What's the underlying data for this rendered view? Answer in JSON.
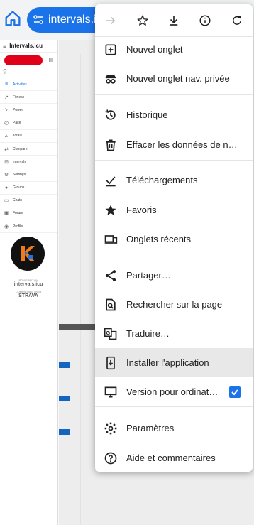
{
  "browser": {
    "url": "intervals.icu"
  },
  "app": {
    "title": "Intervals.icu",
    "sidebar": [
      {
        "label": "Activities",
        "icon": "list-icon"
      },
      {
        "label": "Fitness",
        "icon": "trend-icon"
      },
      {
        "label": "Power",
        "icon": "bolt-icon"
      },
      {
        "label": "Pace",
        "icon": "stopwatch-icon"
      },
      {
        "label": "Totals",
        "icon": "sum-icon"
      },
      {
        "label": "Compare",
        "icon": "compare-icon"
      },
      {
        "label": "Intervals",
        "icon": "intervals-icon"
      },
      {
        "label": "Settings",
        "icon": "gear-icon"
      },
      {
        "label": "Groups",
        "icon": "group-icon"
      },
      {
        "label": "Chats",
        "icon": "chat-icon"
      },
      {
        "label": "Forum",
        "icon": "forum-icon"
      },
      {
        "label": "Profile",
        "icon": "profile-icon"
      }
    ],
    "powered_by": "POWERED BY",
    "powered_brand": "intervals.icu",
    "compat": "COMPATIBLE WITH",
    "strava": "STRAVA"
  },
  "menu": {
    "items": [
      {
        "label": "Nouvel onglet",
        "icon": "new-tab-icon"
      },
      {
        "label": "Nouvel onglet nav. privée",
        "icon": "incognito-icon"
      },
      {
        "label": "Historique",
        "icon": "history-icon"
      },
      {
        "label": "Effacer les données de navi…",
        "icon": "trash-icon"
      },
      {
        "label": "Téléchargements",
        "icon": "downloads-icon"
      },
      {
        "label": "Favoris",
        "icon": "star-icon"
      },
      {
        "label": "Onglets récents",
        "icon": "devices-icon"
      },
      {
        "label": "Partager…",
        "icon": "share-icon"
      },
      {
        "label": "Rechercher sur la page",
        "icon": "find-in-page-icon"
      },
      {
        "label": "Traduire…",
        "icon": "translate-icon"
      },
      {
        "label": "Installer l'application",
        "icon": "install-app-icon"
      },
      {
        "label": "Version pour ordinat…",
        "icon": "desktop-icon"
      },
      {
        "label": "Paramètres",
        "icon": "gear-icon"
      },
      {
        "label": "Aide et commentaires",
        "icon": "help-icon"
      }
    ],
    "desktop_checked": true
  }
}
